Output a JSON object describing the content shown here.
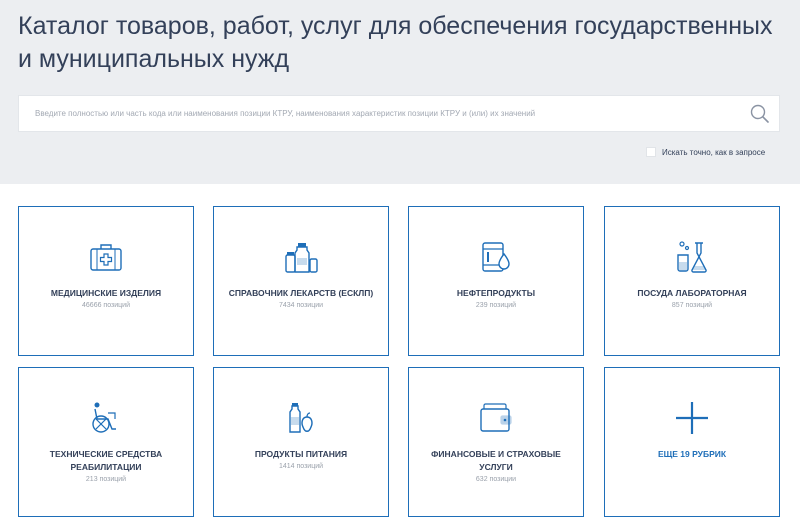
{
  "page": {
    "title": "Каталог товаров, работ, услуг для обеспечения государственных и муниципальных нужд"
  },
  "search": {
    "placeholder": "Введите полностью или часть кода или наименования позиции КТРУ, наименования характеристик позиции КТРУ и (или) их значений",
    "value": "",
    "icon": "search-icon"
  },
  "exact_match": {
    "label": "Искать точно, как в запросе",
    "checked": false
  },
  "colors": {
    "accent": "#1e6eb8",
    "title": "#334059",
    "hero_bg": "#eceef1"
  },
  "categories": [
    {
      "name": "МЕДИЦИНСКИЕ ИЗДЕЛИЯ",
      "count": "46666 позиций",
      "icon": "medical-kit-icon"
    },
    {
      "name": "СПРАВОЧНИК ЛЕКАРСТВ (ЕСКЛП)",
      "count": "7434 позиции",
      "icon": "medicine-bottles-icon"
    },
    {
      "name": "НЕФТЕПРОДУКТЫ",
      "count": "239 позиций",
      "icon": "oil-barrel-icon"
    },
    {
      "name": "ПОСУДА ЛАБОРАТОРНАЯ",
      "count": "857 позиций",
      "icon": "lab-flask-icon"
    },
    {
      "name": "ТЕХНИЧЕСКИЕ СРЕДСТВА РЕАБИЛИТАЦИИ",
      "count": "213 позиций",
      "icon": "wheelchair-icon"
    },
    {
      "name": "ПРОДУКТЫ ПИТАНИЯ",
      "count": "1414 позиций",
      "icon": "food-products-icon"
    },
    {
      "name": "ФИНАНСОВЫЕ И СТРАХОВЫЕ УСЛУГИ",
      "count": "632 позиции",
      "icon": "wallet-icon"
    }
  ],
  "more": {
    "label": "ЕЩЕ 19 РУБРИК",
    "icon": "plus-icon"
  }
}
